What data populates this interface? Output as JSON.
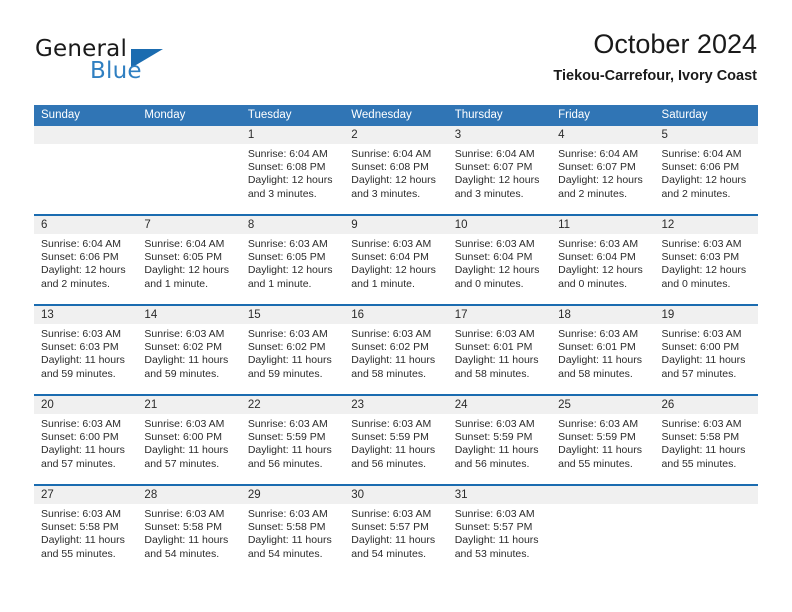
{
  "brand": {
    "name_part1": "General",
    "name_part2": "Blue",
    "accent_color": "#1b6cb0",
    "text_color": "#2f7fc1",
    "triangle_icon": "brand-triangle-icon"
  },
  "header": {
    "title": "October 2024",
    "subtitle": "Tiekou-Carrefour, Ivory Coast"
  },
  "calendar": {
    "header_bg": "#3075b5",
    "row_divider_color": "#1b6cb0",
    "daynum_band_bg": "#f0f0f0",
    "weekday_headers": [
      "Sunday",
      "Monday",
      "Tuesday",
      "Wednesday",
      "Thursday",
      "Friday",
      "Saturday"
    ],
    "weeks": [
      [
        {
          "day": "",
          "sunrise": "",
          "sunset": "",
          "daylight_line1": "",
          "daylight_line2": ""
        },
        {
          "day": "",
          "sunrise": "",
          "sunset": "",
          "daylight_line1": "",
          "daylight_line2": ""
        },
        {
          "day": "1",
          "sunrise": "Sunrise: 6:04 AM",
          "sunset": "Sunset: 6:08 PM",
          "daylight_line1": "Daylight: 12 hours",
          "daylight_line2": "and 3 minutes."
        },
        {
          "day": "2",
          "sunrise": "Sunrise: 6:04 AM",
          "sunset": "Sunset: 6:08 PM",
          "daylight_line1": "Daylight: 12 hours",
          "daylight_line2": "and 3 minutes."
        },
        {
          "day": "3",
          "sunrise": "Sunrise: 6:04 AM",
          "sunset": "Sunset: 6:07 PM",
          "daylight_line1": "Daylight: 12 hours",
          "daylight_line2": "and 3 minutes."
        },
        {
          "day": "4",
          "sunrise": "Sunrise: 6:04 AM",
          "sunset": "Sunset: 6:07 PM",
          "daylight_line1": "Daylight: 12 hours",
          "daylight_line2": "and 2 minutes."
        },
        {
          "day": "5",
          "sunrise": "Sunrise: 6:04 AM",
          "sunset": "Sunset: 6:06 PM",
          "daylight_line1": "Daylight: 12 hours",
          "daylight_line2": "and 2 minutes."
        }
      ],
      [
        {
          "day": "6",
          "sunrise": "Sunrise: 6:04 AM",
          "sunset": "Sunset: 6:06 PM",
          "daylight_line1": "Daylight: 12 hours",
          "daylight_line2": "and 2 minutes."
        },
        {
          "day": "7",
          "sunrise": "Sunrise: 6:04 AM",
          "sunset": "Sunset: 6:05 PM",
          "daylight_line1": "Daylight: 12 hours",
          "daylight_line2": "and 1 minute."
        },
        {
          "day": "8",
          "sunrise": "Sunrise: 6:03 AM",
          "sunset": "Sunset: 6:05 PM",
          "daylight_line1": "Daylight: 12 hours",
          "daylight_line2": "and 1 minute."
        },
        {
          "day": "9",
          "sunrise": "Sunrise: 6:03 AM",
          "sunset": "Sunset: 6:04 PM",
          "daylight_line1": "Daylight: 12 hours",
          "daylight_line2": "and 1 minute."
        },
        {
          "day": "10",
          "sunrise": "Sunrise: 6:03 AM",
          "sunset": "Sunset: 6:04 PM",
          "daylight_line1": "Daylight: 12 hours",
          "daylight_line2": "and 0 minutes."
        },
        {
          "day": "11",
          "sunrise": "Sunrise: 6:03 AM",
          "sunset": "Sunset: 6:04 PM",
          "daylight_line1": "Daylight: 12 hours",
          "daylight_line2": "and 0 minutes."
        },
        {
          "day": "12",
          "sunrise": "Sunrise: 6:03 AM",
          "sunset": "Sunset: 6:03 PM",
          "daylight_line1": "Daylight: 12 hours",
          "daylight_line2": "and 0 minutes."
        }
      ],
      [
        {
          "day": "13",
          "sunrise": "Sunrise: 6:03 AM",
          "sunset": "Sunset: 6:03 PM",
          "daylight_line1": "Daylight: 11 hours",
          "daylight_line2": "and 59 minutes."
        },
        {
          "day": "14",
          "sunrise": "Sunrise: 6:03 AM",
          "sunset": "Sunset: 6:02 PM",
          "daylight_line1": "Daylight: 11 hours",
          "daylight_line2": "and 59 minutes."
        },
        {
          "day": "15",
          "sunrise": "Sunrise: 6:03 AM",
          "sunset": "Sunset: 6:02 PM",
          "daylight_line1": "Daylight: 11 hours",
          "daylight_line2": "and 59 minutes."
        },
        {
          "day": "16",
          "sunrise": "Sunrise: 6:03 AM",
          "sunset": "Sunset: 6:02 PM",
          "daylight_line1": "Daylight: 11 hours",
          "daylight_line2": "and 58 minutes."
        },
        {
          "day": "17",
          "sunrise": "Sunrise: 6:03 AM",
          "sunset": "Sunset: 6:01 PM",
          "daylight_line1": "Daylight: 11 hours",
          "daylight_line2": "and 58 minutes."
        },
        {
          "day": "18",
          "sunrise": "Sunrise: 6:03 AM",
          "sunset": "Sunset: 6:01 PM",
          "daylight_line1": "Daylight: 11 hours",
          "daylight_line2": "and 58 minutes."
        },
        {
          "day": "19",
          "sunrise": "Sunrise: 6:03 AM",
          "sunset": "Sunset: 6:00 PM",
          "daylight_line1": "Daylight: 11 hours",
          "daylight_line2": "and 57 minutes."
        }
      ],
      [
        {
          "day": "20",
          "sunrise": "Sunrise: 6:03 AM",
          "sunset": "Sunset: 6:00 PM",
          "daylight_line1": "Daylight: 11 hours",
          "daylight_line2": "and 57 minutes."
        },
        {
          "day": "21",
          "sunrise": "Sunrise: 6:03 AM",
          "sunset": "Sunset: 6:00 PM",
          "daylight_line1": "Daylight: 11 hours",
          "daylight_line2": "and 57 minutes."
        },
        {
          "day": "22",
          "sunrise": "Sunrise: 6:03 AM",
          "sunset": "Sunset: 5:59 PM",
          "daylight_line1": "Daylight: 11 hours",
          "daylight_line2": "and 56 minutes."
        },
        {
          "day": "23",
          "sunrise": "Sunrise: 6:03 AM",
          "sunset": "Sunset: 5:59 PM",
          "daylight_line1": "Daylight: 11 hours",
          "daylight_line2": "and 56 minutes."
        },
        {
          "day": "24",
          "sunrise": "Sunrise: 6:03 AM",
          "sunset": "Sunset: 5:59 PM",
          "daylight_line1": "Daylight: 11 hours",
          "daylight_line2": "and 56 minutes."
        },
        {
          "day": "25",
          "sunrise": "Sunrise: 6:03 AM",
          "sunset": "Sunset: 5:59 PM",
          "daylight_line1": "Daylight: 11 hours",
          "daylight_line2": "and 55 minutes."
        },
        {
          "day": "26",
          "sunrise": "Sunrise: 6:03 AM",
          "sunset": "Sunset: 5:58 PM",
          "daylight_line1": "Daylight: 11 hours",
          "daylight_line2": "and 55 minutes."
        }
      ],
      [
        {
          "day": "27",
          "sunrise": "Sunrise: 6:03 AM",
          "sunset": "Sunset: 5:58 PM",
          "daylight_line1": "Daylight: 11 hours",
          "daylight_line2": "and 55 minutes."
        },
        {
          "day": "28",
          "sunrise": "Sunrise: 6:03 AM",
          "sunset": "Sunset: 5:58 PM",
          "daylight_line1": "Daylight: 11 hours",
          "daylight_line2": "and 54 minutes."
        },
        {
          "day": "29",
          "sunrise": "Sunrise: 6:03 AM",
          "sunset": "Sunset: 5:58 PM",
          "daylight_line1": "Daylight: 11 hours",
          "daylight_line2": "and 54 minutes."
        },
        {
          "day": "30",
          "sunrise": "Sunrise: 6:03 AM",
          "sunset": "Sunset: 5:57 PM",
          "daylight_line1": "Daylight: 11 hours",
          "daylight_line2": "and 54 minutes."
        },
        {
          "day": "31",
          "sunrise": "Sunrise: 6:03 AM",
          "sunset": "Sunset: 5:57 PM",
          "daylight_line1": "Daylight: 11 hours",
          "daylight_line2": "and 53 minutes."
        },
        {
          "day": "",
          "sunrise": "",
          "sunset": "",
          "daylight_line1": "",
          "daylight_line2": ""
        },
        {
          "day": "",
          "sunrise": "",
          "sunset": "",
          "daylight_line1": "",
          "daylight_line2": ""
        }
      ]
    ]
  }
}
